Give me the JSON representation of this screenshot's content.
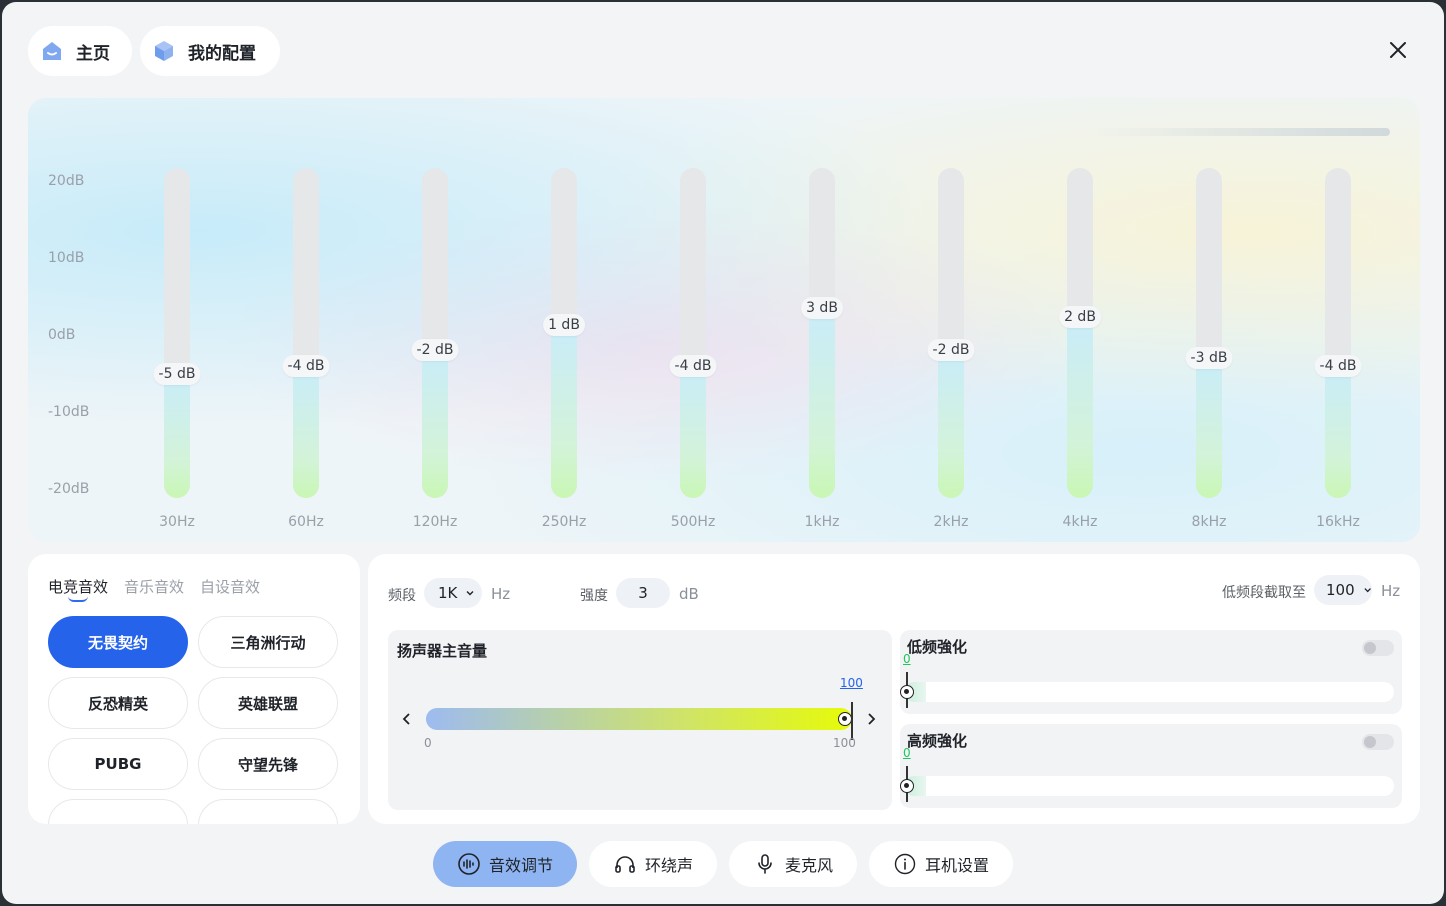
{
  "nav": {
    "home_label": "主页",
    "config_label": "我的配置"
  },
  "eq": {
    "db_labels": [
      "20dB",
      "10dB",
      "0dB",
      "-10dB",
      "-20dB"
    ],
    "range_db": [
      -20,
      20
    ],
    "bands": [
      {
        "freq": "30Hz",
        "gain_db": -5,
        "label": "-5 dB"
      },
      {
        "freq": "60Hz",
        "gain_db": -4,
        "label": "-4 dB"
      },
      {
        "freq": "120Hz",
        "gain_db": -2,
        "label": "-2 dB"
      },
      {
        "freq": "250Hz",
        "gain_db": 1,
        "label": "1 dB"
      },
      {
        "freq": "500Hz",
        "gain_db": -4,
        "label": "-4 dB"
      },
      {
        "freq": "1kHz",
        "gain_db": 3,
        "label": "3 dB"
      },
      {
        "freq": "2kHz",
        "gain_db": -2,
        "label": "-2 dB"
      },
      {
        "freq": "4kHz",
        "gain_db": 2,
        "label": "2 dB"
      },
      {
        "freq": "8kHz",
        "gain_db": -3,
        "label": "-3 dB"
      },
      {
        "freq": "16kHz",
        "gain_db": -4,
        "label": "-4 dB"
      }
    ]
  },
  "presets": {
    "tabs": [
      "电竞音效",
      "音乐音效",
      "自设音效"
    ],
    "active_tab": "电竞音效",
    "items": [
      "无畏契约",
      "三角洲行动",
      "反恐精英",
      "英雄联盟",
      "PUBG",
      "守望先锋"
    ],
    "active_item": "无畏契约"
  },
  "controls": {
    "band_label": "频段",
    "band_value": "1K",
    "band_unit": "Hz",
    "strength_label": "强度",
    "strength_value": "3",
    "strength_unit": "dB",
    "lowcut_label": "低频段截取至",
    "lowcut_value": "100",
    "lowcut_unit": "Hz"
  },
  "volume": {
    "title": "扬声器主音量",
    "value": 100,
    "value_label": "100",
    "min_label": "0",
    "max_label": "100"
  },
  "bass_boost": {
    "title": "低频強化",
    "value_label": "0",
    "enabled": false
  },
  "treble_boost": {
    "title": "高频強化",
    "value_label": "0",
    "enabled": false
  },
  "bottom_nav": {
    "items": [
      "音效调节",
      "环绕声",
      "麦克风",
      "耳机设置"
    ],
    "active": "音效调节"
  },
  "colors": {
    "accent": "#2563eb",
    "active_nav": "#8fb4f2",
    "boost_value": "#22c55e"
  }
}
